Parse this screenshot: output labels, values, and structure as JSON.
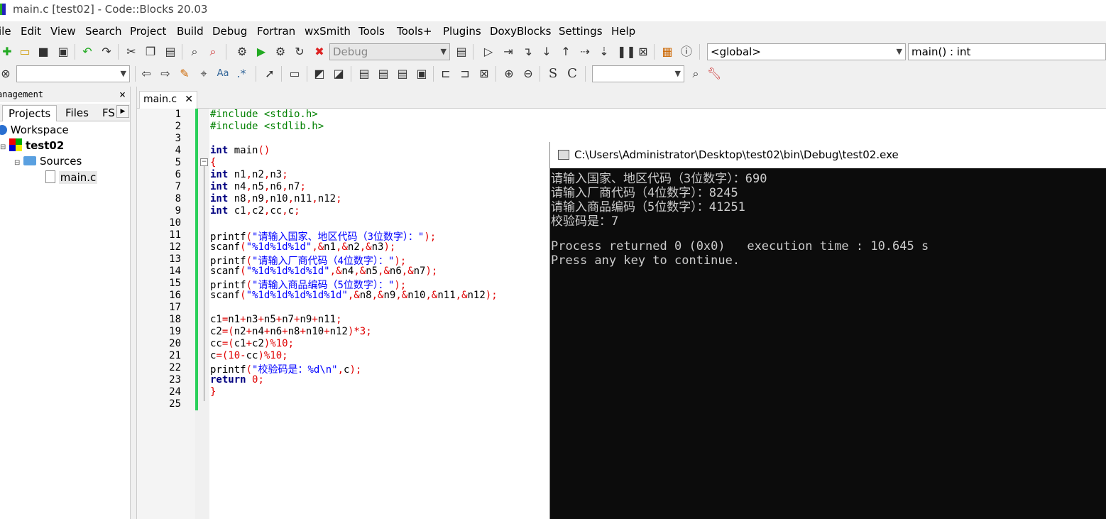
{
  "window": {
    "title": "main.c [test02] - Code::Blocks 20.03"
  },
  "menu": [
    "ile",
    "Edit",
    "View",
    "Search",
    "Project",
    "Build",
    "Debug",
    "Fortran",
    "wxSmith",
    "Tools",
    "Tools+",
    "Plugins",
    "DoxyBlocks",
    "Settings",
    "Help"
  ],
  "toolbar": {
    "build_target": "Debug",
    "scope": "<global>",
    "function": "main() : int",
    "search_value": "",
    "find_value": ""
  },
  "management": {
    "header": "anagement",
    "tabs": [
      "Projects",
      "Files",
      "FS"
    ],
    "tree": {
      "workspace": "Workspace",
      "project": "test02",
      "folder": "Sources",
      "file": "main.c"
    }
  },
  "editor": {
    "tab": "main.c",
    "line_numbers": [
      "1",
      "2",
      "3",
      "4",
      "5",
      "6",
      "7",
      "8",
      "9",
      "10",
      "11",
      "12",
      "13",
      "14",
      "15",
      "16",
      "17",
      "18",
      "19",
      "20",
      "21",
      "22",
      "23",
      "24",
      "25"
    ]
  },
  "console": {
    "title": "C:\\Users\\Administrator\\Desktop\\test02\\bin\\Debug\\test02.exe",
    "lines": [
      "请输入国家、地区代码（3位数字）：690",
      "请输入厂商代码（4位数字）：8245",
      "请输入商品编码（5位数字）：41251",
      "校验码是：7",
      "",
      "Process returned 0 (0x0)   execution time : 10.645 s",
      "Press any key to continue."
    ]
  }
}
